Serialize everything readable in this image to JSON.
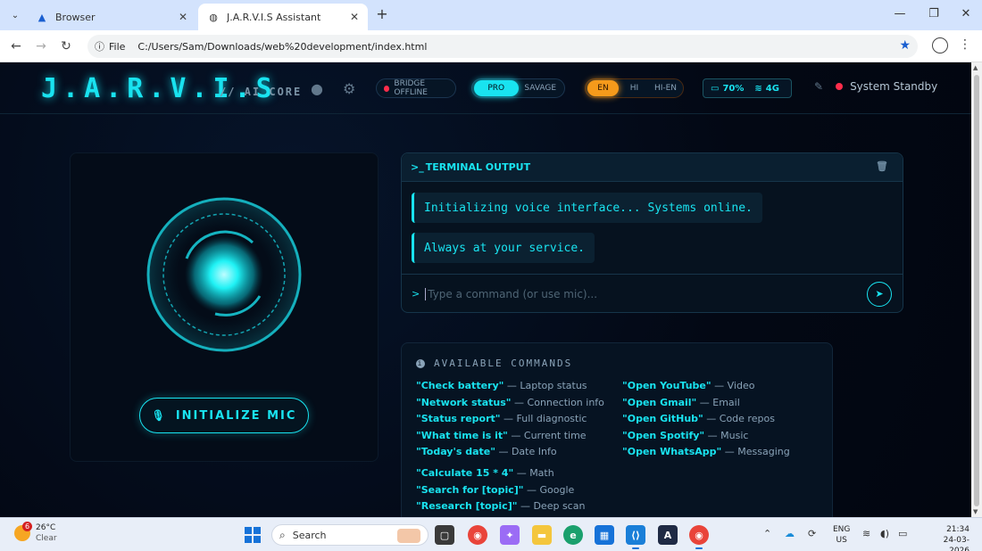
{
  "browser": {
    "tabs": [
      {
        "label": "Browser",
        "active": false
      },
      {
        "label": "J.A.R.V.I.S Assistant",
        "active": true
      }
    ],
    "address": {
      "scheme_label": "File",
      "url": "C:/Users/Sam/Downloads/web%20development/index.html"
    }
  },
  "header": {
    "logo": "J.A.R.V.I.S",
    "subtitle": "// AI CORE",
    "bridge_status": "BRIDGE OFFLINE",
    "modes": [
      "PRO",
      "SAVAGE"
    ],
    "active_mode": "PRO",
    "languages": [
      "EN",
      "HI",
      "HI-EN"
    ],
    "active_language": "EN",
    "battery": "70%",
    "network": "4G",
    "system_status": "System Standby"
  },
  "orb_panel": {
    "mic_button": "INITIALIZE MIC"
  },
  "terminal": {
    "title": "TERMINAL OUTPUT",
    "messages": [
      "Initializing voice interface... Systems online.",
      "Always at your service."
    ],
    "input_placeholder": "Type a command (or use mic)..."
  },
  "commands": {
    "title": "AVAILABLE COMMANDS",
    "left": [
      {
        "cmd": "\"Check battery\"",
        "desc": " — Laptop status"
      },
      {
        "cmd": "\"Network status\"",
        "desc": " — Connection info"
      },
      {
        "cmd": "\"Status report\"",
        "desc": " — Full diagnostic"
      },
      {
        "cmd": "\"What time is it\"",
        "desc": " — Current time"
      },
      {
        "cmd": "\"Today's date\"",
        "desc": " — Date Info"
      }
    ],
    "right": [
      {
        "cmd": "\"Open YouTube\"",
        "desc": " — Video"
      },
      {
        "cmd": "\"Open Gmail\"",
        "desc": " — Email"
      },
      {
        "cmd": "\"Open GitHub\"",
        "desc": " — Code repos"
      },
      {
        "cmd": "\"Open Spotify\"",
        "desc": " — Music"
      },
      {
        "cmd": "\"Open WhatsApp\"",
        "desc": " — Messaging"
      }
    ],
    "extra": [
      {
        "cmd": "\"Calculate 15 * 4\"",
        "desc": " — Math"
      },
      {
        "cmd": "\"Search for [topic]\"",
        "desc": " — Google"
      },
      {
        "cmd": "\"Research [topic]\"",
        "desc": " — Deep scan"
      }
    ]
  },
  "taskbar": {
    "weather_temp": "26°C",
    "weather_desc": "Clear",
    "weather_badge": "6",
    "search_placeholder": "Search",
    "lang_line1": "ENG",
    "lang_line2": "US",
    "time": "21:34",
    "date": "24-03-2026"
  },
  "colors": {
    "accent": "#19e3f0",
    "lang_accent": "#f59a1b",
    "status_red": "#ff2d4b"
  }
}
